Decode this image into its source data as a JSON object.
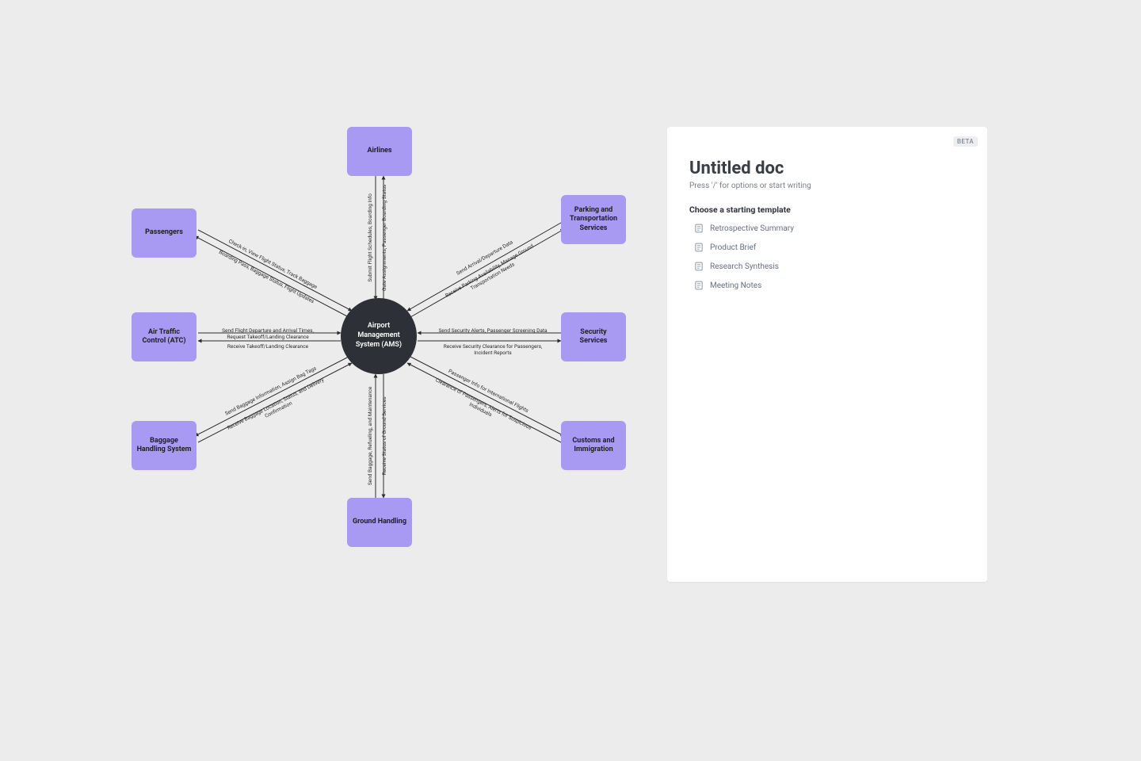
{
  "diagram": {
    "center": {
      "label": "Airport Management System (AMS)"
    },
    "nodes": {
      "airlines": "Airlines",
      "passengers": "Passengers",
      "atc": "Air Traffic Control (ATC)",
      "baggage": "Baggage Handling System",
      "ground": "Ground Handling",
      "customs": "Customs and Immigration",
      "security": "Security Services",
      "parking": "Parking and Transportation Services"
    },
    "edges": {
      "airlines_to_center": "Submit Flight Schedules, Boarding Info",
      "center_to_airlines": "Gate Assignments, Passenger Boarding Status",
      "passengers_to_center": "Check-in, View Flight Status, Track Baggage",
      "center_to_passengers": "Boarding Pass, Baggage Status, Flight Updates",
      "atc_to_center": "Send Flight Departure and Arrival Times, Request Takeoff/Landing Clearance",
      "center_to_atc": "Receive Takeoff/Landing Clearance",
      "baggage_to_center": "Send Baggage Information, Assign Bag Tags",
      "center_to_baggage": "Receive Baggage Location, Status, and Delivery Confirmation",
      "ground_to_center": "Send Baggage, Refueling, and Maintenance",
      "center_to_ground": "Receive Status of Ground Services",
      "customs_to_center": "Passenger Info for International Flights",
      "center_to_customs": "Clearance of Passengers, Alerts for Suspicious Individuals",
      "security_to_center": "Send Security Alerts, Passenger Screening Data",
      "center_to_security": "Receive Security Clearance for Passengers, Incident Reports",
      "parking_to_center": "Send Arrival/Departure Data",
      "center_to_parking": "Receive Parking Availability, Manage Ground Transportation Needs"
    }
  },
  "doc": {
    "badge": "BETA",
    "title": "Untitled doc",
    "hint": "Press '/' for options or start writing",
    "template_heading": "Choose a starting template",
    "templates": [
      "Retrospective Summary",
      "Product Brief",
      "Research Synthesis",
      "Meeting Notes"
    ]
  }
}
